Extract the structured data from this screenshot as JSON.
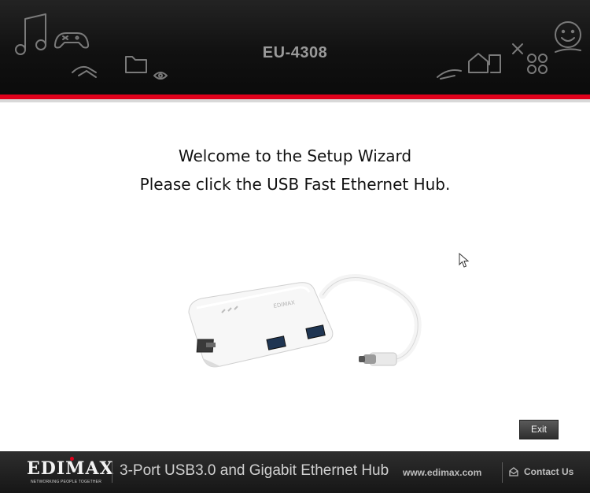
{
  "header": {
    "title": "EU-4308",
    "icons": [
      "music-note-icon",
      "gamepad-icon",
      "handshake-icon",
      "folder-icon",
      "eye-icon",
      "pencil-icon",
      "house-icon",
      "network-icon",
      "smiley-icon"
    ]
  },
  "main": {
    "heading_line1": "Welcome to the Setup Wizard",
    "heading_line2": "Please click the USB Fast Ethernet Hub.",
    "product_image": "usb-ethernet-hub",
    "product_brand_print": "EDIMAX",
    "exit_label": "Exit"
  },
  "footer": {
    "brand": "EDIMAX",
    "tagline": "NETWORKING PEOPLE TOGETHER",
    "product_name": "3-Port USB3.0 and Gigabit Ethernet Hub",
    "url": "www.edimax.com",
    "contact_label": "Contact Us"
  },
  "colors": {
    "accent_red": "#e0001b",
    "header_bg": "#111111",
    "footer_bg": "#1e1e1e"
  }
}
